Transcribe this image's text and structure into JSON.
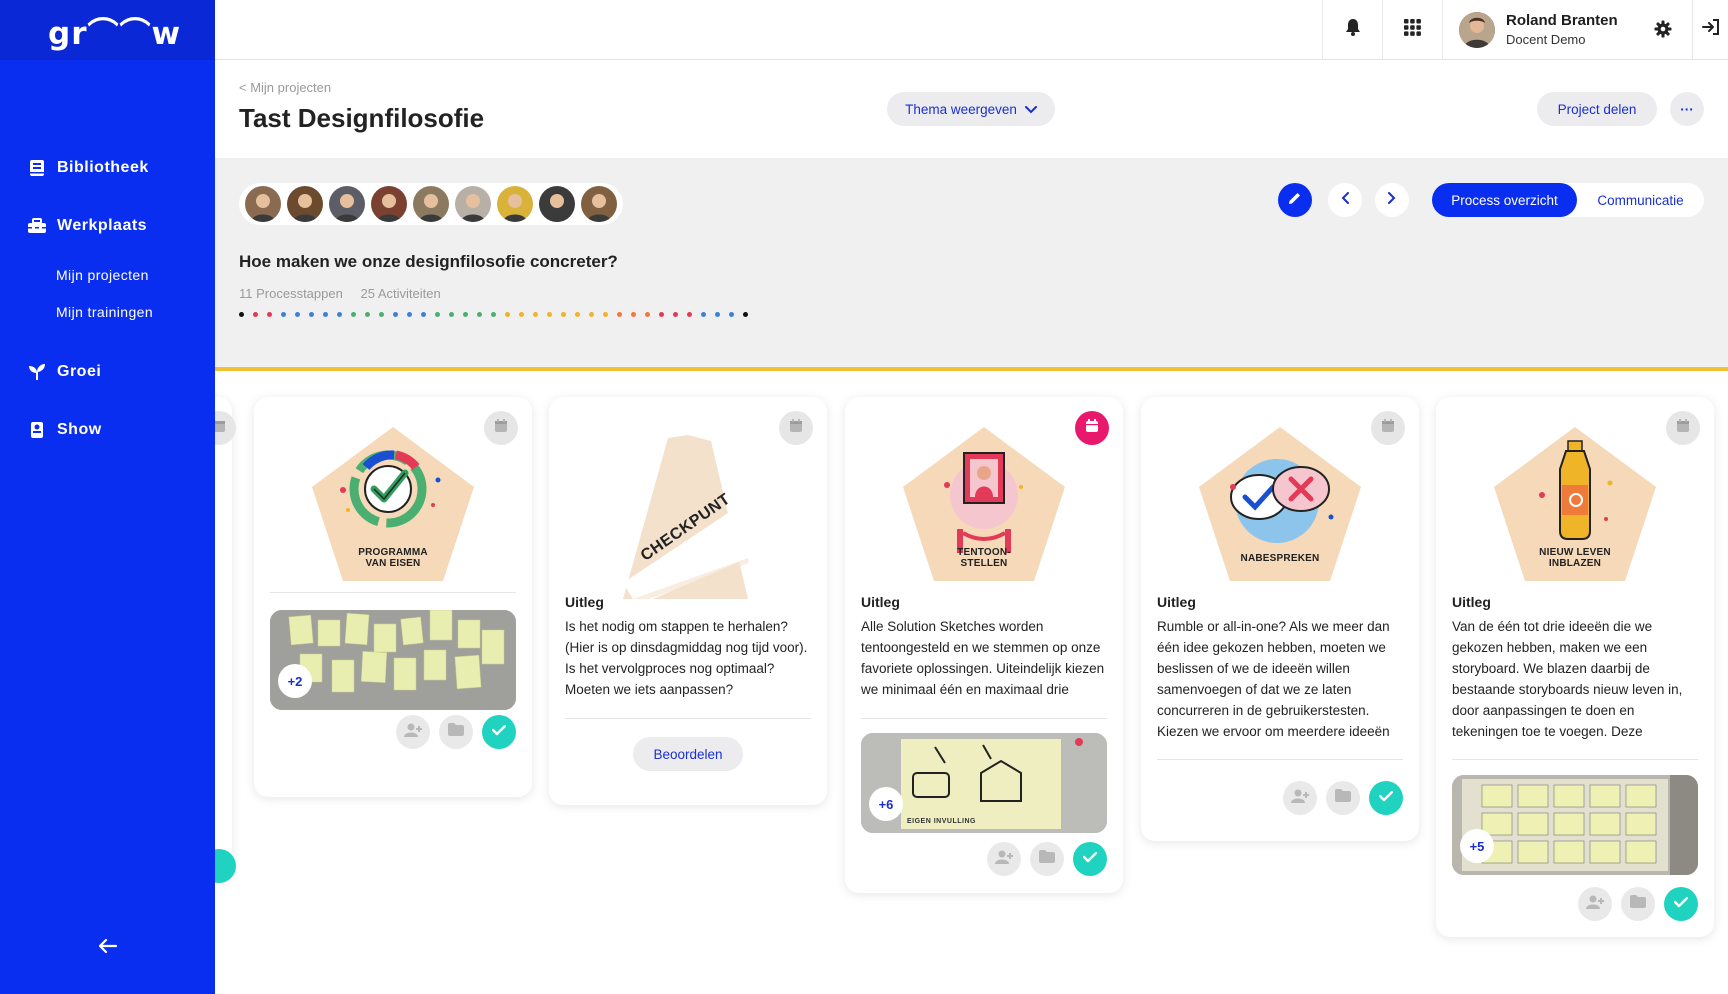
{
  "app": {
    "logo_text": "gr⌒⌒w"
  },
  "sidebar": {
    "items": [
      {
        "label": "Bibliotheek",
        "icon": "book-icon"
      },
      {
        "label": "Werkplaats",
        "icon": "toolbox-icon"
      },
      {
        "label": "Mijn projecten"
      },
      {
        "label": "Mijn trainingen"
      },
      {
        "label": "Groei",
        "icon": "sprout-icon"
      },
      {
        "label": "Show",
        "icon": "show-icon"
      }
    ],
    "collapse_icon": "arrow-left-icon"
  },
  "topbar": {
    "notification_icon": "bell-icon",
    "apps_icon": "grid-icon",
    "user_name": "Roland Branten",
    "user_role": "Docent Demo",
    "settings_icon": "gear-icon",
    "logout_icon": "logout-icon"
  },
  "header": {
    "breadcrumb": "< Mijn projecten",
    "title": "Tast Designfilosofie",
    "theme_button": "Thema weergeven",
    "share_button": "Project delen",
    "more_button": "···"
  },
  "project": {
    "question": "Hoe maken we onze designfilosofie concreter?",
    "steps": "11 Processtappen",
    "activities": "25 Activiteiten",
    "avatar_colors": [
      "#8a6a50",
      "#6b4a2e",
      "#5d5d68",
      "#7a4030",
      "#8c7a60",
      "#b8b0a6",
      "#d9b23a",
      "#3b3b3b",
      "#806040"
    ],
    "dot_colors": [
      "#111111",
      "#e23a57",
      "#e23a57",
      "#3b82d6",
      "#3b82d6",
      "#3b82d6",
      "#3b82d6",
      "#3b82d6",
      "#4caf72",
      "#4caf72",
      "#4caf72",
      "#3b82d6",
      "#3b82d6",
      "#3b82d6",
      "#4caf72",
      "#4caf72",
      "#4caf72",
      "#4caf72",
      "#4caf72",
      "#f0b429",
      "#f0b429",
      "#f0b429",
      "#f0b429",
      "#f0b429",
      "#f0b429",
      "#f0b429",
      "#f0b429",
      "#f07a3a",
      "#f07a3a",
      "#f07a3a",
      "#e23a57",
      "#e23a57",
      "#e23a57",
      "#3b82d6",
      "#3b82d6",
      "#3b82d6",
      "#111111"
    ],
    "tab_active": "Process overzicht",
    "tab_other": "Communicatie"
  },
  "colors": {
    "brand_blue": "#0a2ef0",
    "accent_yellow": "#f1c232",
    "done_teal": "#1fd3c0",
    "calendar_pink": "#e8196c"
  },
  "cards": [
    {
      "label_line1": "PROGRAMMA",
      "label_line2": "VAN EISEN",
      "photo_count": "+2"
    },
    {
      "type": "checkpoint",
      "stamp": "CHECKPUNT",
      "uitleg_heading": "Uitleg",
      "uitleg_text": "Is het nodig om stappen te herhalen? (Hier is op dinsdagmiddag nog tijd voor). Is het vervolgproces nog optimaal? Moeten we iets aanpassen?",
      "review_button": "Beoordelen"
    },
    {
      "label_line1": "TENTOON-",
      "label_line2": "STELLEN",
      "uitleg_heading": "Uitleg",
      "uitleg_text": "Alle Solution Sketches worden tentoongesteld en we stemmen op onze favoriete oplossingen. Uiteindelijk kiezen we minimaal één en maximaal drie favoriete ideeën uit.",
      "photo_count": "+6",
      "photo_caption": "EIGEN INVULLING"
    },
    {
      "label_line1": "NABESPREKEN",
      "label_line2": "",
      "uitleg_heading": "Uitleg",
      "uitleg_text": "Rumble or all-in-one? Als we meer dan één idee gekozen hebben, moeten we beslissen of we de ideeën willen samenvoegen of dat we ze laten concurreren in de gebruikerstesten. Kiezen we ervoor om meerdere ideeën te testen, dan splitsen we het team op in"
    },
    {
      "label_line1": "NIEUW LEVEN",
      "label_line2": "INBLAZEN",
      "uitleg_heading": "Uitleg",
      "uitleg_text": "Van de één tot drie ideeën die we gekozen hebben, maken we een storyboard. We blazen daarbij de bestaande storyboards nieuw leven in, door aanpassingen te doen en tekeningen toe te voegen. Deze storyboards zijn ieder vijf tot vijftien",
      "photo_count": "+5"
    }
  ]
}
